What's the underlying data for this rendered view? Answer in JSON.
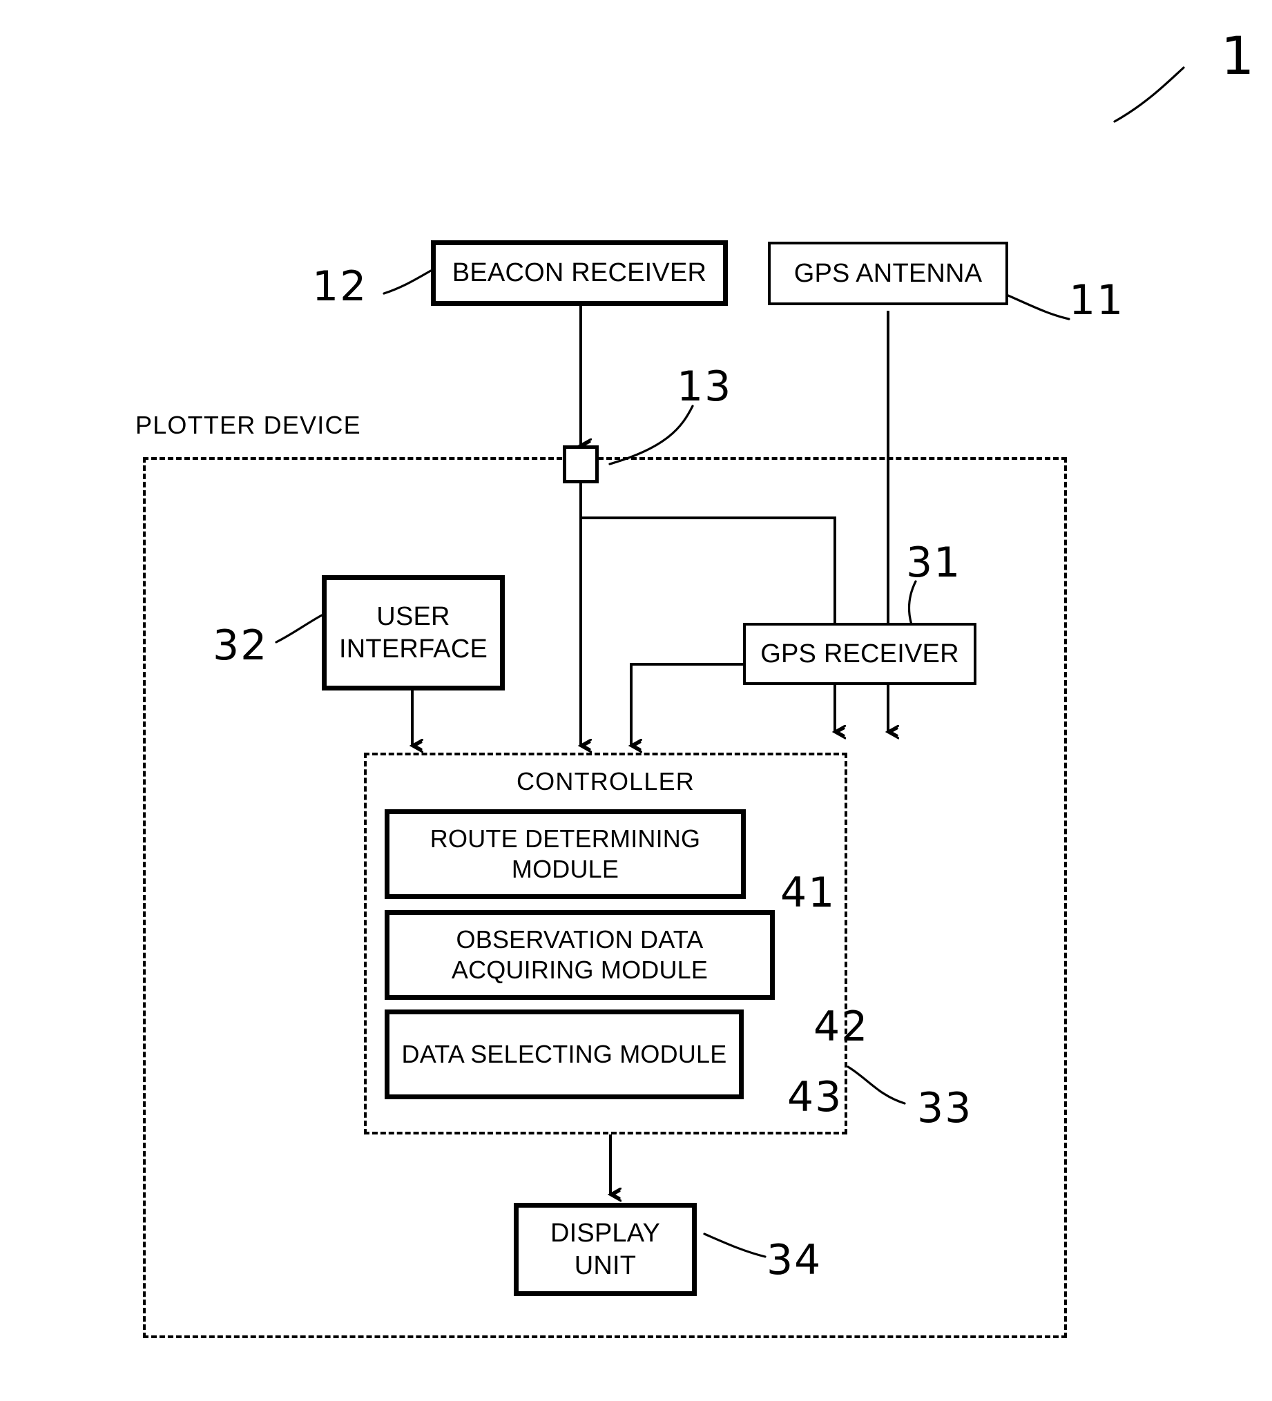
{
  "figure": {
    "number": "1",
    "outer_label": "PLOTTER DEVICE"
  },
  "blocks": {
    "beacon_receiver": {
      "label": "BEACON RECEIVER",
      "ref": "12"
    },
    "gps_antenna": {
      "label": "GPS ANTENNA",
      "ref": "11"
    },
    "node_13": {
      "label": "",
      "ref": "13"
    },
    "user_interface": {
      "line1": "USER",
      "line2": "INTERFACE",
      "ref": "32"
    },
    "gps_receiver": {
      "label": "GPS RECEIVER",
      "ref": "31"
    },
    "controller": {
      "label": "CONTROLLER",
      "ref": "33"
    },
    "route_module": {
      "line1": "ROUTE DETERMINING",
      "line2": "MODULE",
      "ref": "41"
    },
    "observation_module": {
      "line1": "OBSERVATION DATA",
      "line2": "ACQUIRING MODULE",
      "ref": "42"
    },
    "data_selecting_module": {
      "label": "DATA SELECTING MODULE",
      "ref": "43"
    },
    "display_unit": {
      "line1": "DISPLAY",
      "line2": "UNIT",
      "ref": "34"
    }
  },
  "colors": {
    "ink": "#000000",
    "paper": "#ffffff"
  }
}
